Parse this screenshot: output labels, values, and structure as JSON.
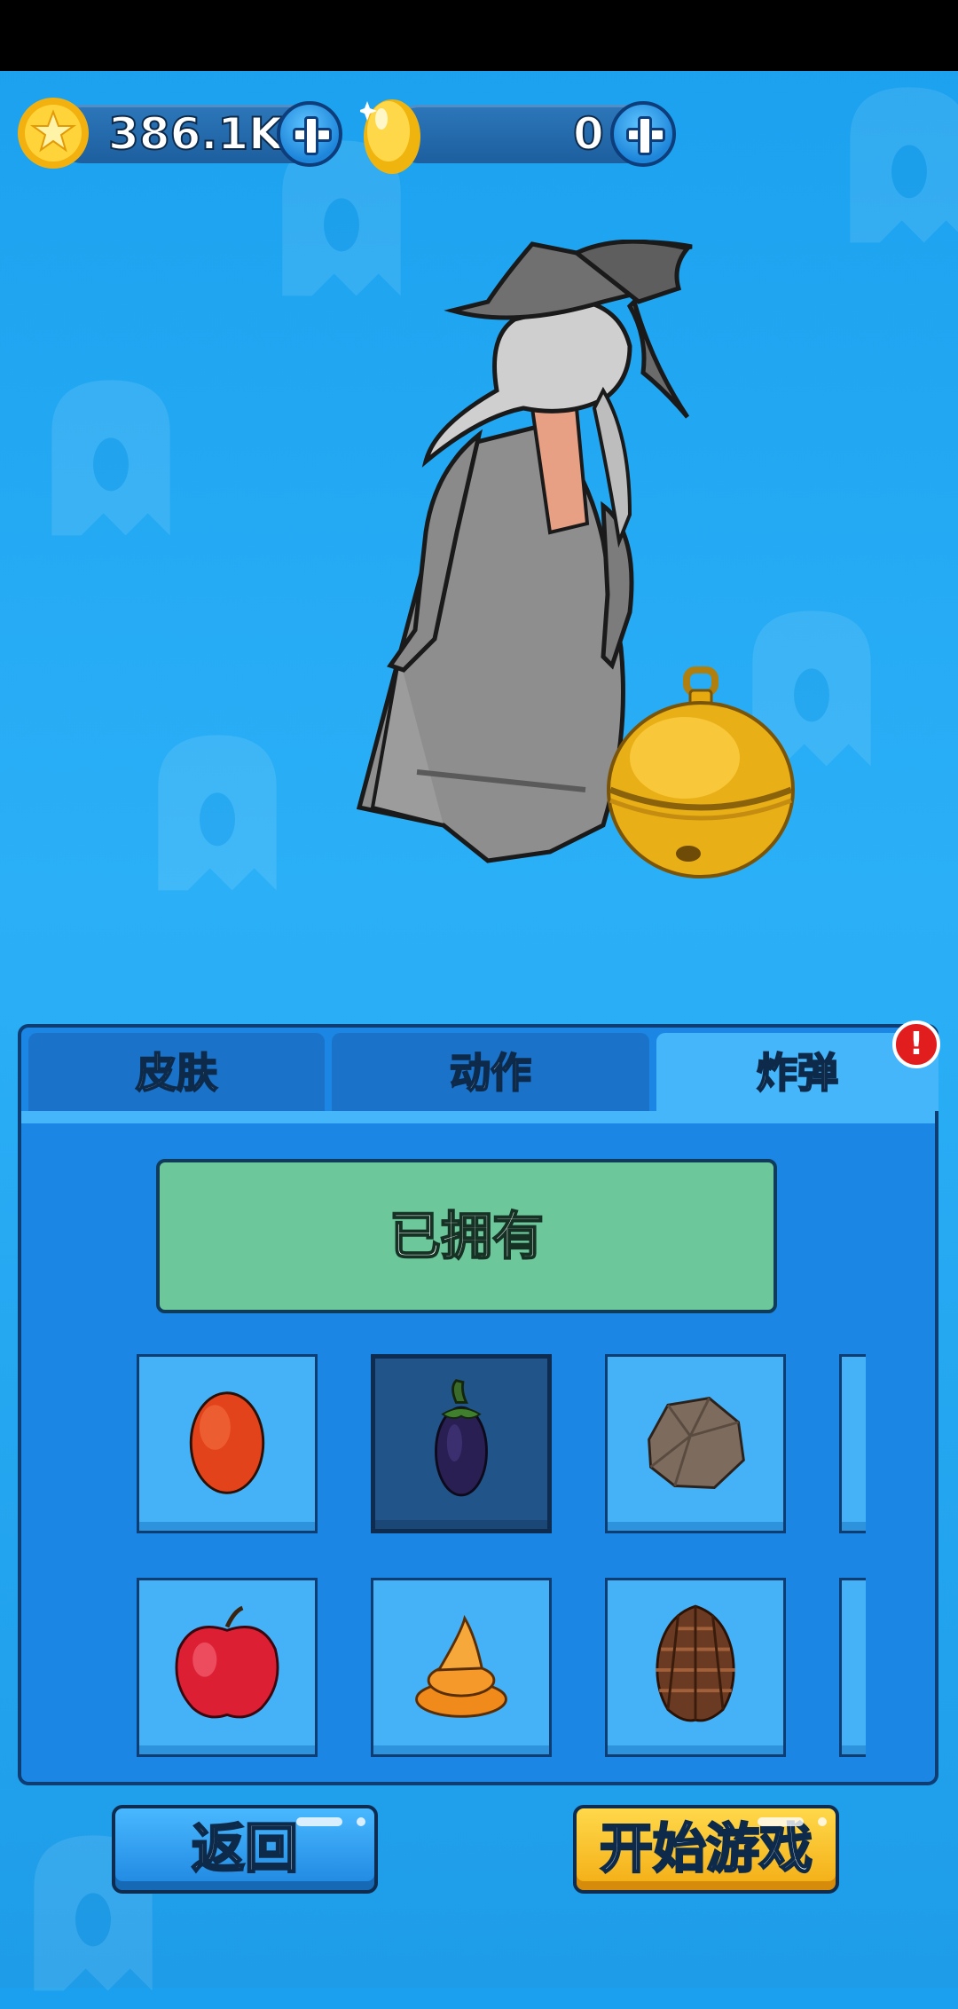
{
  "currency": {
    "coins": "386.1K",
    "gems": "0"
  },
  "tabs": [
    {
      "label": "皮肤"
    },
    {
      "label": "动作"
    },
    {
      "label": "炸弹"
    }
  ],
  "active_tab_index": 2,
  "notification_badge": "!",
  "owned_label": "已拥有",
  "items": [
    {
      "icon": "egg-icon",
      "selected": false
    },
    {
      "icon": "eggplant-icon",
      "selected": true
    },
    {
      "icon": "rock-icon",
      "selected": false
    },
    {
      "icon": "apple-icon",
      "selected": false
    },
    {
      "icon": "poop-icon",
      "selected": false
    },
    {
      "icon": "pinecone-icon",
      "selected": false
    }
  ],
  "buttons": {
    "back": "返回",
    "start": "开始游戏"
  },
  "colors": {
    "background": "#1aa0ee",
    "panel": "#1b86e4",
    "active_tab": "#46b6fb",
    "owned_button": "#6cc79b",
    "start_button": "#f7c22a"
  }
}
